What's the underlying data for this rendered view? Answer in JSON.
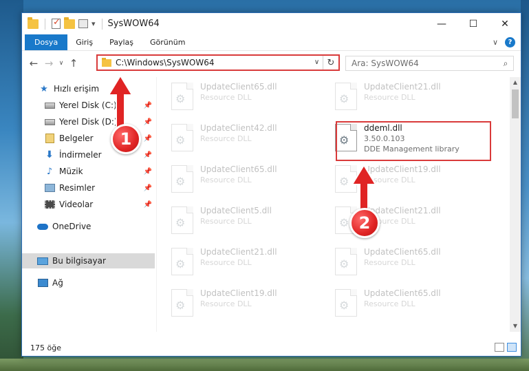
{
  "window": {
    "title": "SysWOW64",
    "minimize_glyph": "—",
    "maximize_glyph": "☐",
    "close_glyph": "✕"
  },
  "ribbon": {
    "tabs": [
      "Dosya",
      "Giriş",
      "Paylaş",
      "Görünüm"
    ],
    "help_glyph": "?"
  },
  "nav": {
    "back_glyph": "←",
    "forward_glyph": "→",
    "recent_glyph": "∨",
    "up_glyph": "↑",
    "address": "C:\\Windows\\SysWOW64",
    "dropdown_glyph": "∨",
    "refresh_glyph": "↻",
    "search_placeholder": "Ara: SysWOW64",
    "search_glyph": "⌕"
  },
  "sidebar": {
    "quick_access": "Hızlı erişim",
    "items": [
      {
        "label": "Yerel Disk (C:)",
        "icon": "hard-disk-icon"
      },
      {
        "label": "Yerel Disk (D:)",
        "icon": "hard-disk-icon"
      },
      {
        "label": "Belgeler",
        "icon": "documents-icon"
      },
      {
        "label": "İndirmeler",
        "icon": "downloads-icon"
      },
      {
        "label": "Müzik",
        "icon": "music-icon"
      },
      {
        "label": "Resimler",
        "icon": "pictures-icon"
      },
      {
        "label": "Videolar",
        "icon": "videos-icon"
      }
    ],
    "onedrive": "OneDrive",
    "this_pc": "Bu bilgisayar",
    "network": "Ağ"
  },
  "files": {
    "left_column": [
      {
        "name": "UpdateClient65.dll",
        "type": "Resource DLL"
      },
      {
        "name": "UpdateClient42.dll",
        "type": "Resource DLL"
      },
      {
        "name": "UpdateClient65.dll",
        "type": "Resource DLL"
      },
      {
        "name": "UpdateClient5.dll",
        "type": "Resource DLL"
      },
      {
        "name": "UpdateClient21.dll",
        "type": "Resource DLL"
      },
      {
        "name": "UpdateClient19.dll",
        "type": "Resource DLL"
      }
    ],
    "right_column": [
      {
        "name": "UpdateClient21.dll",
        "type": "Resource DLL"
      },
      {
        "name": "ddeml.dll",
        "version": "3.50.0.103",
        "description": "DDE Management library"
      },
      {
        "name": "UpdateClient19.dll",
        "type": "Resource DLL"
      },
      {
        "name": "UpdateClient21.dll",
        "type": "Resource DLL"
      },
      {
        "name": "UpdateClient65.dll",
        "type": "Resource DLL"
      },
      {
        "name": "UpdateClient65.dll",
        "type": "Resource DLL"
      }
    ]
  },
  "status": {
    "item_count": "175 öğe"
  },
  "annotations": {
    "step1": "1",
    "step2": "2",
    "color": "#e02424"
  }
}
